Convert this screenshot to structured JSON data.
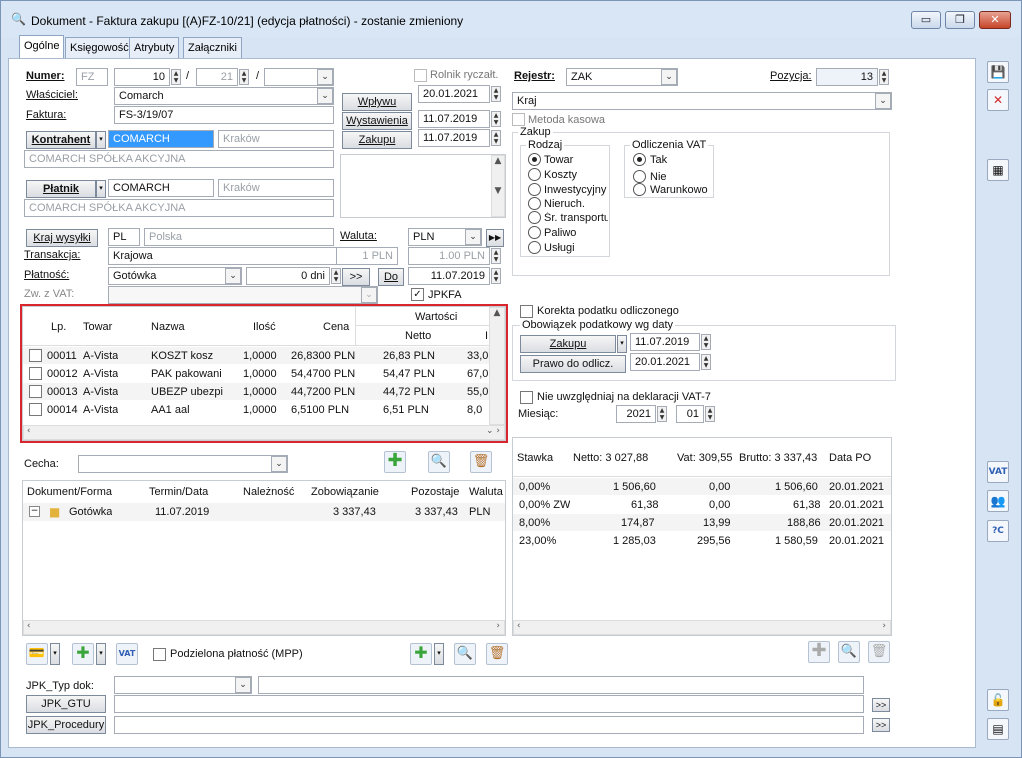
{
  "window": {
    "title": "Dokument - Faktura zakupu [(A)FZ-10/21] (edycja płatności) - zostanie zmieniony"
  },
  "tabs": [
    "Ogólne",
    "Księgowość",
    "Atrybuty",
    "Załączniki"
  ],
  "header": {
    "numer_label": "Numer:",
    "numer_prefix": "FZ",
    "numer_value": "10",
    "numer_year": "21",
    "wlasciciel_label": "Właściciel:",
    "wlasciciel_value": "Comarch",
    "faktura_label": "Faktura:",
    "faktura_value": "FS-3/19/07",
    "rolnik_label": "Rolnik ryczałt.",
    "wplywu_btn": "Wpływu",
    "wplywu_date": "20.01.2021",
    "wystawienia_btn": "Wystawienia",
    "wystawienia_date": "11.07.2019",
    "zakupu_btn": "Zakupu",
    "zakupu_date": "11.07.2019",
    "kontrahent_btn": "Kontrahent",
    "kontrahent_code": "COMARCH",
    "kontrahent_city": "Kraków",
    "kontrahent_name": "COMARCH SPÓŁKA AKCYJNA",
    "platnik_btn": "Płatnik",
    "platnik_code": "COMARCH",
    "platnik_city": "Kraków",
    "platnik_name": "COMARCH SPÓŁKA AKCYJNA",
    "kraj_wysylki_btn": "Kraj wysyłki",
    "kraj_code": "PL",
    "kraj_name": "Polska",
    "waluta_label": "Waluta:",
    "waluta_value": "PLN",
    "transakcja_label": "Transakcja:",
    "transakcja_value": "Krajowa",
    "kurs_1": "1 PLN",
    "kurs_2": "1.00 PLN",
    "platnosc_label": "Płatność:",
    "platnosc_value": "Gotówka",
    "platnosc_dni": "0 dni",
    "arrow_btn": ">>",
    "do_btn": "Do",
    "do_date": "11.07.2019",
    "zw_vat_label": "Zw. z VAT:",
    "jpkfa_label": "JPKFA"
  },
  "right_panel": {
    "rejestr_label": "Rejestr:",
    "rejestr_value": "ZAK",
    "pozycja_label": "Pozycja:",
    "pozycja_value": "13",
    "kraj_value": "Kraj",
    "metoda_label": "Metoda kasowa",
    "zakup_label": "Zakup",
    "rodzaj_label": "Rodzaj",
    "rodzaj_options": [
      "Towar",
      "Koszty",
      "Inwestycyjny",
      "Nieruch.",
      "Śr. transportu",
      "Paliwo",
      "Usługi"
    ],
    "rodzaj_selected": "Towar",
    "odliczenia_label": "Odliczenia VAT",
    "odliczenia_options": [
      "Tak",
      "Nie",
      "Warunkowo"
    ],
    "odliczenia_selected": "Tak",
    "korekta_label": "Korekta podatku odliczonego",
    "obowiazek_label": "Obowiązek podatkowy wg daty",
    "zakupu_btn": "Zakupu",
    "zakupu_date": "11.07.2019",
    "prawo_btn": "Prawo do odlicz.",
    "prawo_date": "20.01.2021",
    "nie_uwzgl_label": "Nie uwzględniaj na deklaracji VAT-7",
    "miesiac_label": "Miesiąc:",
    "miesiac_year": "2021",
    "miesiac_month": "01"
  },
  "items_grid": {
    "columns": [
      "Lp.",
      "Towar",
      "Nazwa",
      "Ilość",
      "Cena",
      "Wartości",
      "Netto",
      "I"
    ],
    "rows": [
      {
        "lp": "00011",
        "towar": "A-Vista",
        "nazwa": "KOSZT kosz",
        "ilosc": "1,0000",
        "cena": "26,8300 PLN",
        "netto": "26,83 PLN",
        "next": "33,0"
      },
      {
        "lp": "00012",
        "towar": "A-Vista",
        "nazwa": "PAK pakowani",
        "ilosc": "1,0000",
        "cena": "54,4700 PLN",
        "netto": "54,47 PLN",
        "next": "67,0"
      },
      {
        "lp": "00013",
        "towar": "A-Vista",
        "nazwa": "UBEZP ubezpie",
        "ilosc": "1,0000",
        "cena": "44,7200 PLN",
        "netto": "44,72 PLN",
        "next": "55,0"
      },
      {
        "lp": "00014",
        "towar": "A-Vista",
        "nazwa": "AA1 aal",
        "ilosc": "1,0000",
        "cena": "6,5100 PLN",
        "netto": "6,51 PLN",
        "next": "8,0"
      }
    ]
  },
  "cecha": {
    "label": "Cecha:"
  },
  "payments_grid": {
    "columns": [
      "Dokument/Forma",
      "Termin/Data",
      "Należność",
      "Zobowiązanie",
      "Pozostaje",
      "Waluta"
    ],
    "rows": [
      {
        "forma": "Gotówka",
        "termin": "11.07.2019",
        "naleznosc": "",
        "zobowiazanie": "3 337,43",
        "pozostaje": "3 337,43",
        "waluta": "PLN"
      }
    ]
  },
  "vat_grid": {
    "columns": [
      "Stawka",
      "Netto: 3 027,88",
      "Vat: 309,55",
      "Brutto: 3 337,43",
      "Data PO"
    ],
    "rows": [
      {
        "stawka": "0,00%",
        "netto": "1 506,60",
        "vat": "0,00",
        "brutto": "1 506,60",
        "data": "20.01.2021"
      },
      {
        "stawka": "0,00% ZW",
        "netto": "61,38",
        "vat": "0,00",
        "brutto": "61,38",
        "data": "20.01.2021"
      },
      {
        "stawka": "8,00%",
        "netto": "174,87",
        "vat": "13,99",
        "brutto": "188,86",
        "data": "20.01.2021"
      },
      {
        "stawka": "23,00%",
        "netto": "1 285,03",
        "vat": "295,56",
        "brutto": "1 580,59",
        "data": "20.01.2021"
      }
    ]
  },
  "bottom": {
    "podzielona_label": "Podzielona płatność (MPP)",
    "vat_icon_label": "VAT",
    "jpk_typ_label": "JPK_Typ dok:",
    "jpk_gtu_btn": "JPK_GTU",
    "jpk_procedury_btn": "JPK_Procedury",
    "arrow": ">>"
  },
  "colors": {
    "highlight_border": "#d9262e",
    "selection": "#3399ff"
  }
}
